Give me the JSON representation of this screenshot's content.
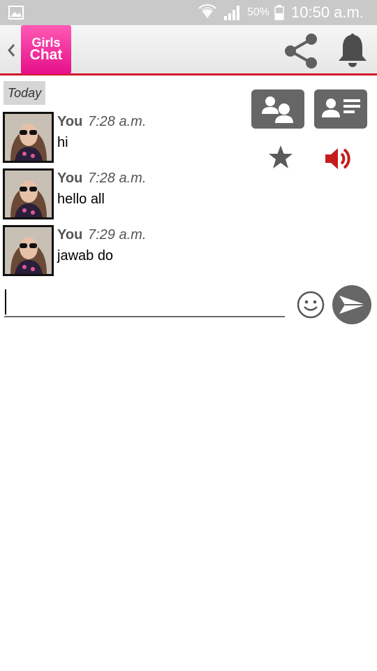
{
  "status_bar": {
    "battery_percent": "50%",
    "time": "10:50 a.m.",
    "icons": [
      "gallery-icon",
      "wifi-icon",
      "signal-icon",
      "battery-icon"
    ]
  },
  "app_bar": {
    "logo_line1": "Girls",
    "logo_line2": "Chat",
    "icons": [
      "back-icon",
      "share-icon",
      "bell-icon"
    ],
    "accent_color": "#d21a2a",
    "logo_color": "#f0359e"
  },
  "chat": {
    "date_label": "Today",
    "messages": [
      {
        "sender": "You",
        "time": "7:28 a.m.",
        "text": "hi"
      },
      {
        "sender": "You",
        "time": "7:28 a.m.",
        "text": "hello all"
      },
      {
        "sender": "You",
        "time": "7:29 a.m.",
        "text": "jawab do"
      }
    ]
  },
  "actions": {
    "icons": [
      "users-icon",
      "profile-card-icon",
      "star-icon",
      "volume-icon"
    ],
    "volume_color": "#c41d1d"
  },
  "composer": {
    "input_value": "",
    "icons": [
      "emoji-icon",
      "send-icon"
    ]
  }
}
